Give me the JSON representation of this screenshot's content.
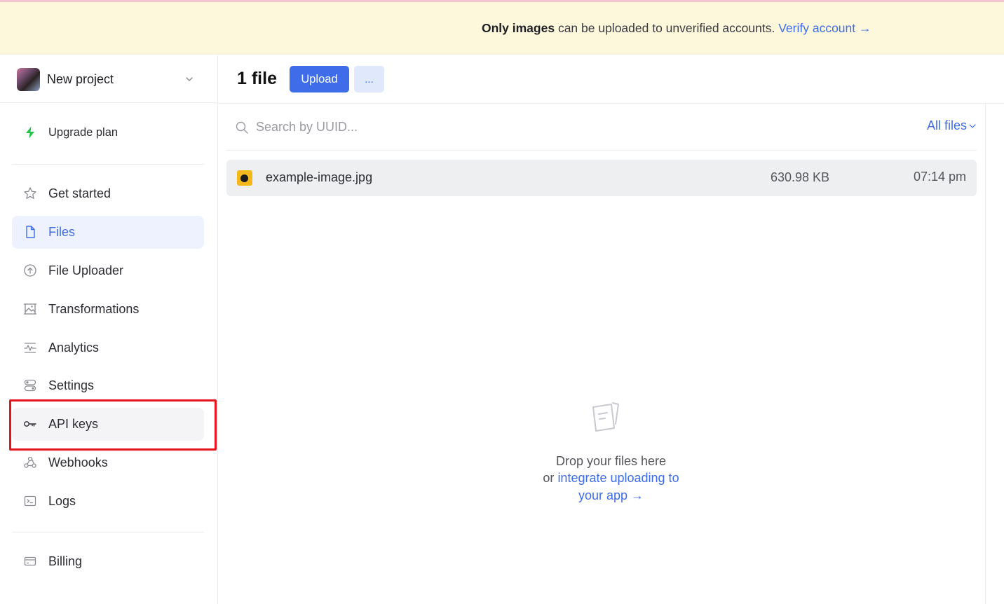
{
  "banner": {
    "bold_text": "Only images",
    "text": " can be uploaded to unverified accounts. ",
    "link_text": "Verify account →"
  },
  "sidebar": {
    "project_name": "New project",
    "upgrade_label": "Upgrade plan",
    "items": [
      {
        "label": "Get started",
        "icon": "star-icon"
      },
      {
        "label": "Files",
        "icon": "file-icon"
      },
      {
        "label": "File Uploader",
        "icon": "upload-circle-icon"
      },
      {
        "label": "Transformations",
        "icon": "image-transform-icon"
      },
      {
        "label": "Analytics",
        "icon": "analytics-icon"
      },
      {
        "label": "Settings",
        "icon": "settings-toggle-icon"
      },
      {
        "label": "API keys",
        "icon": "key-icon"
      },
      {
        "label": "Webhooks",
        "icon": "webhook-icon"
      },
      {
        "label": "Logs",
        "icon": "terminal-icon"
      }
    ],
    "billing_label": "Billing",
    "active_item": "Files",
    "highlighted_item": "API keys"
  },
  "main": {
    "file_count": "1 file",
    "upload_label": "Upload",
    "more_label": "...",
    "search_placeholder": "Search by UUID...",
    "filter_label": "All files",
    "files": [
      {
        "name": "example-image.jpg",
        "size": "630.98 KB",
        "time": "07:14 pm"
      }
    ],
    "drop_text_1": "Drop your files here",
    "drop_text_or": "or ",
    "drop_link_1": "integrate uploading to",
    "drop_link_2": "your app →"
  },
  "colors": {
    "accent": "#3f6ce8",
    "banner_bg": "#fdf8dc",
    "active_bg": "#eef2fe",
    "highlight_border": "#e5141c"
  }
}
